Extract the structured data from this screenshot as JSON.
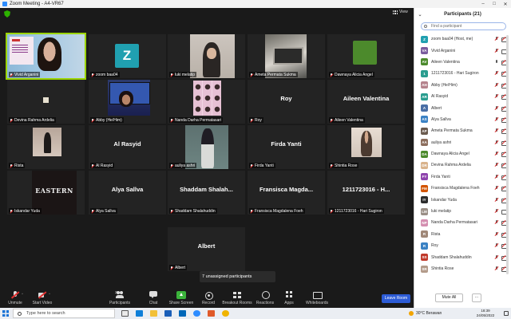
{
  "window": {
    "title": "Zoom Meeting - A4-VR67",
    "controls": [
      "–",
      "□",
      "✕"
    ]
  },
  "meeting": {
    "view_label": "View",
    "unassigned_text": "7 unassigned participants",
    "tiles": [
      {
        "label": "Vivid Arganini",
        "video": "vivid",
        "active": true
      },
      {
        "label": "zoom baa04",
        "video": "avatar",
        "avatar_text": "Z"
      },
      {
        "label": "luki melatip",
        "video": "luki"
      },
      {
        "label": "Ameta Permata Sukma",
        "video": "ameta"
      },
      {
        "label": "Dawnaya Alicia Angel",
        "video": "dawnaya"
      },
      {
        "label": "Devina Rahma Ardelia",
        "video": "devina"
      },
      {
        "label": "Abby (He/Him)",
        "video": "abby"
      },
      {
        "label": "Nanda Darha Permatasari",
        "video": "nanda"
      },
      {
        "label": "Roy",
        "name": "Roy"
      },
      {
        "label": "Aileen Valentina",
        "name": "Aileen Valentina"
      },
      {
        "label": "Rista",
        "video": "rista"
      },
      {
        "label": "Al Rasyid",
        "name": "Al Rasyid"
      },
      {
        "label": "auliya ashri",
        "video": "aulya"
      },
      {
        "label": "Firda Yanti",
        "name": "Firda Yanti"
      },
      {
        "label": "Shintia Rose",
        "video": "shintia"
      },
      {
        "label": "Iskandar Yuda",
        "video": "iskandar",
        "video_text": "EASTERN"
      },
      {
        "label": "Alya Sallva",
        "name": "Alya Sallva"
      },
      {
        "label": "Shaddam Shalahuddin",
        "name": "Shaddam  Shalah..."
      },
      {
        "label": "Fransisca Magdalena Foeh",
        "name": "Fransisca  Magda..."
      },
      {
        "label": "1211723016 - Hari Sugiron",
        "name": "1211723016 - H..."
      },
      {
        "label": "Albert",
        "name": "Albert"
      }
    ]
  },
  "toolbar": {
    "unmute": "Unmute",
    "start_video": "Start Video",
    "participants": "Participants",
    "participants_count": "21",
    "chat": "Chat",
    "share_screen": "Share Screen",
    "record": "Record",
    "breakout_rooms": "Breakout Rooms",
    "reactions": "Reactions",
    "apps": "Apps",
    "whiteboards": "Whiteboards",
    "leave": "Leave Room",
    "caret": "^"
  },
  "panel": {
    "collapse_icon": "⌄",
    "title": "Participants (21)",
    "search_placeholder": "Find a participant",
    "mute_all": "Mute All",
    "more": "...",
    "participants": [
      {
        "initials": "Z",
        "color": "#20a0b0",
        "name": "zoom baa04 (Host, me)",
        "mic_on": false,
        "cam_on": false
      },
      {
        "initials": "VA",
        "color": "#7a5c9e",
        "name": "Vivid Arganini",
        "mic_on": false,
        "cam_on": true
      },
      {
        "initials": "AV",
        "color": "#4c8a2c",
        "name": "Aileen Valentina",
        "mic_on": true,
        "cam_on": false
      },
      {
        "initials": "1",
        "color": "#2a9d8f",
        "name": "1211723016 - Hari Sugiron",
        "mic_on": false,
        "cam_on": false
      },
      {
        "initials": "AH",
        "color": "#b5838d",
        "name": "Abby (He/Him)",
        "mic_on": false,
        "cam_on": false
      },
      {
        "initials": "AR",
        "color": "#2a9d8f",
        "name": "Al Rasyid",
        "mic_on": false,
        "cam_on": false
      },
      {
        "initials": "A",
        "color": "#4a6fa5",
        "name": "Albert",
        "mic_on": false,
        "cam_on": false
      },
      {
        "initials": "AS",
        "color": "#3b82c4",
        "name": "Alya Sallva",
        "mic_on": false,
        "cam_on": false
      },
      {
        "initials": "AP",
        "color": "#6b5b4f",
        "name": "Ameta Permata Sukma",
        "mic_on": false,
        "cam_on": false
      },
      {
        "initials": "AA",
        "color": "#8c6e5d",
        "name": "auliya ashri",
        "mic_on": false,
        "cam_on": false
      },
      {
        "initials": "DA",
        "color": "#4c8a2c",
        "name": "Dawnaya Alicia Angel",
        "mic_on": false,
        "cam_on": false
      },
      {
        "initials": "DR",
        "color": "#d9b38c",
        "name": "Devina Rahma Ardelia",
        "mic_on": false,
        "cam_on": false
      },
      {
        "initials": "FY",
        "color": "#8e44ad",
        "name": "Firda Yanti",
        "mic_on": false,
        "cam_on": false
      },
      {
        "initials": "FM",
        "color": "#d35400",
        "name": "Fransisca Magdalena Foeh",
        "mic_on": false,
        "cam_on": false
      },
      {
        "initials": "IY",
        "color": "#2c2c2c",
        "name": "Iskandar Yuda",
        "mic_on": false,
        "cam_on": false
      },
      {
        "initials": "LM",
        "color": "#9a8f86",
        "name": "luki melatip",
        "mic_on": false,
        "cam_on": true
      },
      {
        "initials": "NP",
        "color": "#d48fb0",
        "name": "Nanda Darha Permatasari",
        "mic_on": false,
        "cam_on": false
      },
      {
        "initials": "R",
        "color": "#a08878",
        "name": "Rista",
        "mic_on": false,
        "cam_on": false
      },
      {
        "initials": "R",
        "color": "#3b82c4",
        "name": "Roy",
        "mic_on": false,
        "cam_on": false
      },
      {
        "initials": "SS",
        "color": "#c0392b",
        "name": "Shaddam Shalahuddin",
        "mic_on": false,
        "cam_on": false
      },
      {
        "initials": "SR",
        "color": "#b39b8a",
        "name": "Shintia Rose",
        "mic_on": false,
        "cam_on": false
      }
    ]
  },
  "taskbar": {
    "search_placeholder": "Type here to search",
    "weather": "30°C  Berawan",
    "time": "18:39",
    "date": "24/05/2022"
  },
  "colors": {
    "active_speaker": "#9bd400",
    "leave_button": "#2d5cd6",
    "share_green": "#3bb33b",
    "muted_red": "#e02f2f"
  }
}
